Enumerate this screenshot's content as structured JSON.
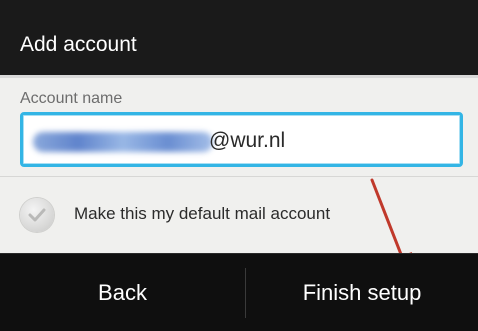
{
  "header": {
    "title": "Add account"
  },
  "form": {
    "account_name_label": "Account name",
    "account_domain": "@wur.nl",
    "default_account_label": "Make this my default mail account",
    "default_account_checked": false
  },
  "footer": {
    "back_label": "Back",
    "finish_label": "Finish setup"
  },
  "colors": {
    "accent": "#33b5e5",
    "annotation_arrow": "#c0392b",
    "header_bg": "#1a1a1a"
  }
}
